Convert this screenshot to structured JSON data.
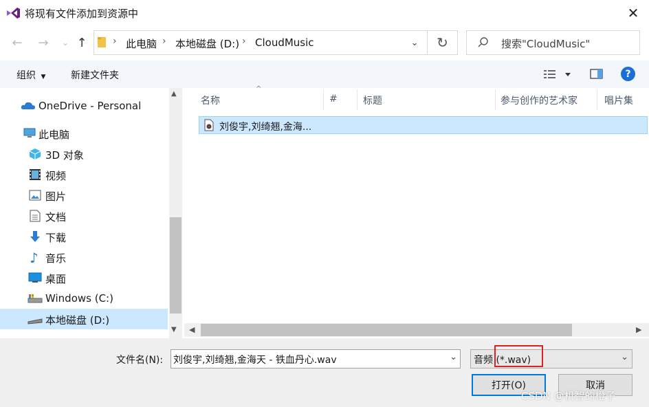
{
  "window": {
    "title": "将现有文件添加到资源中"
  },
  "address": {
    "breadcrumbs": [
      "此电脑",
      "本地磁盘 (D:)",
      "CloudMusic"
    ],
    "separator": "›",
    "search_placeholder": "搜索\"CloudMusic\""
  },
  "toolbar": {
    "organize": "组织",
    "new_folder": "新建文件夹"
  },
  "sidebar": {
    "items": [
      {
        "label": "OneDrive - Personal",
        "icon": "onedrive-icon"
      },
      {
        "label": "此电脑",
        "icon": "computer-icon"
      },
      {
        "label": "3D 对象",
        "icon": "3d-objects-icon"
      },
      {
        "label": "视频",
        "icon": "video-icon"
      },
      {
        "label": "图片",
        "icon": "pictures-icon"
      },
      {
        "label": "文档",
        "icon": "documents-icon"
      },
      {
        "label": "下载",
        "icon": "download-icon"
      },
      {
        "label": "音乐",
        "icon": "music-icon"
      },
      {
        "label": "桌面",
        "icon": "desktop-icon"
      },
      {
        "label": "Windows (C:)",
        "icon": "drive-c-icon"
      },
      {
        "label": "本地磁盘 (D:)",
        "icon": "drive-d-icon",
        "selected": true
      }
    ]
  },
  "columns": [
    "名称",
    "#",
    "标题",
    "参与创作的艺术家",
    "唱片集"
  ],
  "files": [
    {
      "name": "刘俊宇,刘绮翘,金海..."
    }
  ],
  "bottom": {
    "filename_label": "文件名(N):",
    "filename_value": "刘俊宇,刘绮翘,金海天 - 铁血丹心.wav",
    "filter_value": "音频 (*.wav)",
    "open_label": "打开(O)",
    "cancel_label": "取消"
  },
  "watermark": "CSDN @机智的橙子",
  "colors": {
    "accent": "#0078d7",
    "selection": "#cce8ff",
    "highlight": "#e02020",
    "help": "#1a6fd6"
  }
}
